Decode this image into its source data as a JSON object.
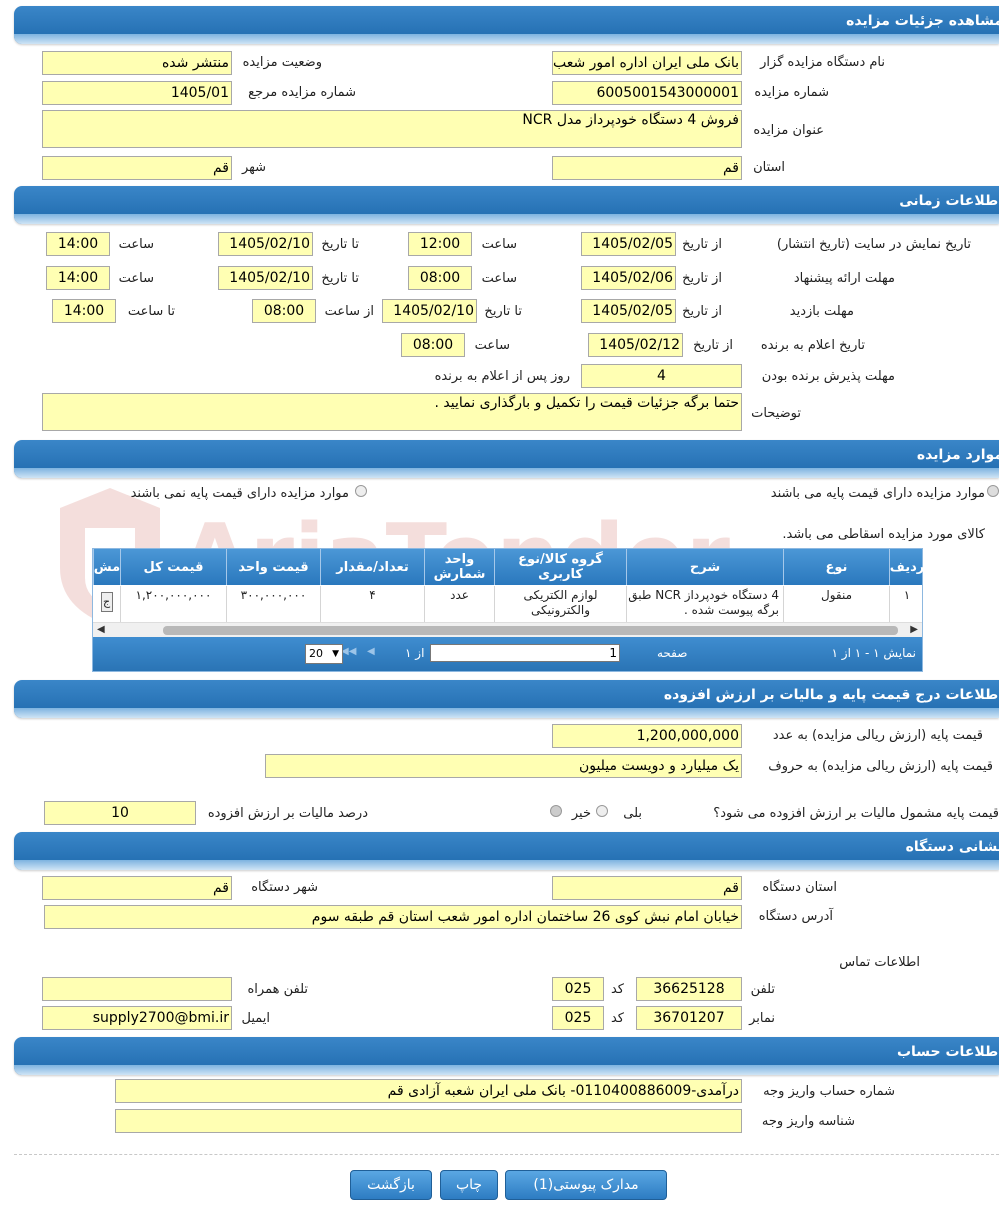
{
  "sections": {
    "details": "مشاهده جزئیات مزایده",
    "timing": "اطلاعات زمانی",
    "items": "موارد مزایده",
    "pricing": "اطلاعات درج قیمت پایه و مالیات بر ارزش افزوده",
    "address": "نشانی دستگاه",
    "account": "اطلاعات حساب"
  },
  "details": {
    "org_label": "نام دستگاه مزایده گزار",
    "org_value": "بانک ملی ایران اداره امور شعب",
    "status_label": "وضعیت مزایده",
    "status_value": "منتشر شده",
    "number_label": "شماره مزایده",
    "number_value": "6005001543000001",
    "ref_label": "شماره مزایده مرجع",
    "ref_value": "1405/01",
    "title_label": "عنوان مزایده",
    "title_value": "فروش 4 دستگاه خودپرداز مدل NCR",
    "province_label": "استان",
    "province_value": "قم",
    "city_label": "شهر",
    "city_value": "قم"
  },
  "timing": {
    "display_label": "تاریخ نمایش در سایت (تاریخ انتشار)",
    "offer_label": "مهلت ارائه پیشنهاد",
    "visit_label": "مهلت بازدید",
    "announce_label": "تاریخ اعلام به برنده",
    "accept_label": "مهلت پذیرش برنده بودن",
    "notes_label": "توضیحات",
    "from_date": "از تاریخ",
    "to_date": "تا تاریخ",
    "time": "ساعت",
    "from_time": "از ساعت",
    "to_time": "تا ساعت",
    "days_after": "روز پس از اعلام به برنده",
    "display_from": "1405/02/05",
    "display_from_time": "12:00",
    "display_to": "1405/02/10",
    "display_to_time": "14:00",
    "offer_from": "1405/02/06",
    "offer_from_time": "08:00",
    "offer_to": "1405/02/10",
    "offer_to_time": "14:00",
    "visit_from": "1405/02/05",
    "visit_to": "1405/02/10",
    "visit_from_time": "08:00",
    "visit_to_time": "14:00",
    "announce_from": "1405/02/12",
    "announce_time": "08:00",
    "accept_days": "4",
    "notes_value": "حتما برگه جزئیات قیمت را تکمیل و بارگذاری نمایید ."
  },
  "items": {
    "with_base": "موارد مزایده دارای قیمت پایه می باشند",
    "without_base": "موارد مزایده دارای قیمت پایه نمی باشند",
    "note": "کالای مورد مزایده اسقاطی می باشد.",
    "headers": [
      "ردیف",
      "نوع",
      "شرح",
      "گروه کالا/نوع کاربری",
      "واحد شمارش",
      "تعداد/مقدار",
      "قیمت واحد",
      "قیمت کل",
      "مش"
    ],
    "row": {
      "index": "۱",
      "type": "منقول",
      "desc": "4 دستگاه خودپرداز NCR طبق برگه پیوست شده .",
      "group": "لوازم الکتریکی والکترونیکی",
      "unit": "عدد",
      "qty": "۴",
      "unit_price": "۳۰۰,۰۰۰,۰۰۰",
      "total": "۱,۲۰۰,۰۰۰,۰۰۰",
      "extra": "ج"
    },
    "footer_display": "نمایش ۱ - ۱ از ۱",
    "footer_page": "صفحه",
    "footer_page_value": "1",
    "footer_of": "از ۱",
    "footer_size": "20"
  },
  "pricing": {
    "base_num_label": "قیمت پایه (ارزش ریالی مزایده) به عدد",
    "base_num_value": "1,200,000,000",
    "base_words_label": "قیمت پایه (ارزش ریالی مزایده) به حروف",
    "base_words_value": "یک میلیارد و دویست میلیون",
    "vat_question": "قیمت پایه مشمول مالیات بر ارزش افزوده می شود؟",
    "yes": "بلی",
    "no": "خیر",
    "vat_percent_label": "درصد مالیات بر ارزش افزوده",
    "vat_percent_value": "10"
  },
  "address": {
    "province_label": "استان دستگاه",
    "province_value": "قم",
    "city_label": "شهر دستگاه",
    "city_value": "قم",
    "address_label": "آدرس دستگاه",
    "address_value": "خیابان امام نبش کوی 26 ساختمان اداره امور شعب استان قم طبقه سوم",
    "contact_label": "اطلاعات تماس",
    "phone_label": "تلفن",
    "phone_value": "36625128",
    "code_label": "کد",
    "phone_code": "025",
    "mobile_label": "تلفن همراه",
    "mobile_value": "",
    "fax_label": "نمابر",
    "fax_value": "36701207",
    "fax_code": "025",
    "email_label": "ایمیل",
    "email_value": "supply2700@bmi.ir"
  },
  "account": {
    "number_label": "شماره حساب واریز وجه",
    "number_value": "درآمدی-0110400886009- بانک ملی ایران شعبه آزادی قم",
    "id_label": "شناسه واریز وجه",
    "id_value": ""
  },
  "buttons": {
    "attachments": "مدارک پیوستی(1)",
    "print": "چاپ",
    "back": "بازگشت"
  },
  "watermark": "AriaTender.net"
}
